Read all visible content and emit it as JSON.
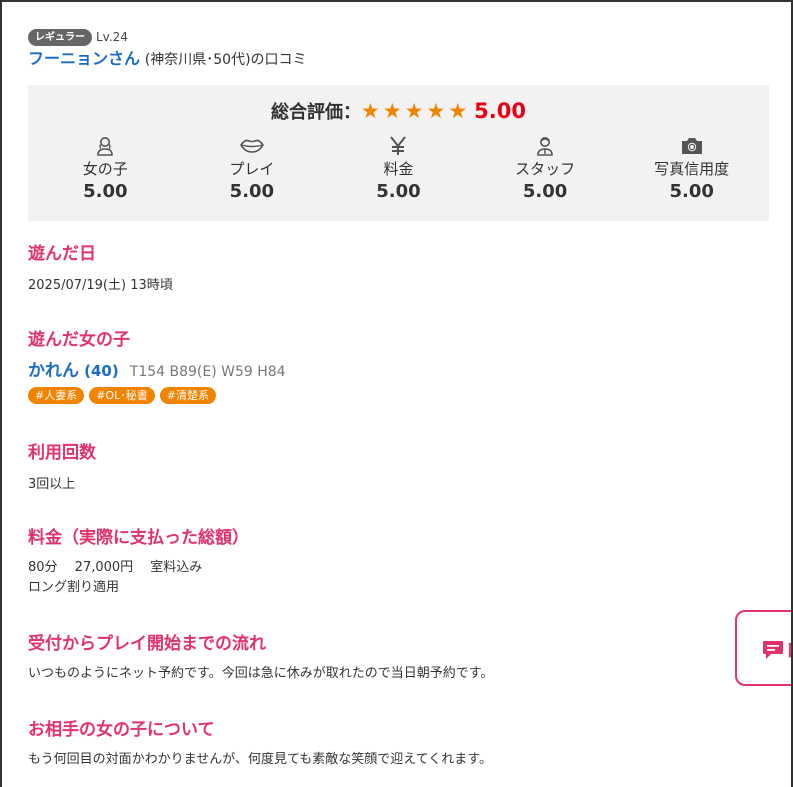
{
  "reviewer": {
    "badge": "レギュラー",
    "level": "Lv.24",
    "name": "フーニョンさん",
    "meta": "(神奈川県･50代)の口コミ"
  },
  "rating": {
    "label": "総合評価：",
    "stars": "★★★★★",
    "score": "5.00",
    "categories": [
      {
        "label": "女の子",
        "value": "5.00",
        "icon": "woman-icon"
      },
      {
        "label": "プレイ",
        "value": "5.00",
        "icon": "lips-icon"
      },
      {
        "label": "料金",
        "value": "5.00",
        "icon": "yen-icon"
      },
      {
        "label": "スタッフ",
        "value": "5.00",
        "icon": "staff-icon"
      },
      {
        "label": "写真信用度",
        "value": "5.00",
        "icon": "camera-icon"
      }
    ]
  },
  "sections": {
    "date": {
      "title": "遊んだ日",
      "text": "2025/07/19(土) 13時頃"
    },
    "girl": {
      "title": "遊んだ女の子",
      "name": "かれん",
      "age": "(40)",
      "spec": "T154 B89(E) W59 H84",
      "tags": [
        "#人妻系",
        "#OL･秘書",
        "#清楚系"
      ]
    },
    "visits": {
      "title": "利用回数",
      "text": "3回以上"
    },
    "price": {
      "title": "料金（実際に支払った総額）",
      "line1": "80分　 27,000円　 室料込み",
      "line2": "ロング割り適用"
    },
    "flow": {
      "title": "受付からプレイ開始までの流れ",
      "text": "いつものようにネット予約です。今回は急に休みが取れたので当日朝予約です。"
    },
    "about": {
      "title": "お相手の女の子について",
      "text": "もう何回目の対面かわかりませんが、何度見ても素敵な笑顔で迎えてくれます。"
    }
  },
  "floating": {
    "label": "口"
  }
}
